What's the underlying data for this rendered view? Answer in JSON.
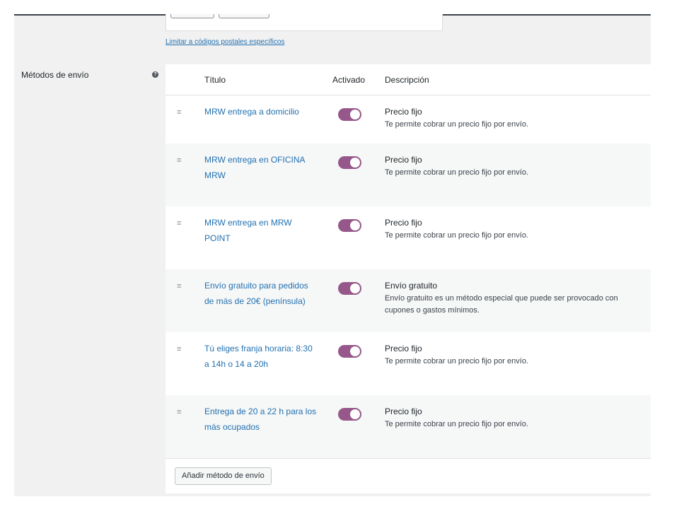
{
  "zone": {
    "limit_postcodes_link": "Limitar a códigos postales específicos",
    "shipping_methods_label": "Métodos de envío",
    "help_icon": "?"
  },
  "table": {
    "headers": {
      "title": "Título",
      "enabled": "Activado",
      "description": "Descripción"
    },
    "rows": [
      {
        "title": "MRW entrega a domicilio",
        "enabled": true,
        "type": "Precio fijo",
        "desc": "Te permite cobrar un precio fijo por envío."
      },
      {
        "title": "MRW entrega en OFICINA MRW",
        "enabled": true,
        "type": "Precio fijo",
        "desc": "Te permite cobrar un precio fijo por envío."
      },
      {
        "title": "MRW entrega en MRW POINT",
        "enabled": true,
        "type": "Precio fijo",
        "desc": "Te permite cobrar un precio fijo por envío."
      },
      {
        "title": "Envío gratuito para pedidos de más de 20€ (península)",
        "enabled": true,
        "type": "Envío gratuito",
        "desc": "Envío gratuito es un método especial que puede ser provocado con cupones o gastos mínimos."
      },
      {
        "title": "Tú eliges franja horaria: 8:30 a 14h o 14 a 20h",
        "enabled": true,
        "type": "Precio fijo",
        "desc": "Te permite cobrar un precio fijo por envío."
      },
      {
        "title": "Entrega de 20 a 22 h para los más ocupados",
        "enabled": true,
        "type": "Precio fijo",
        "desc": "Te permite cobrar un precio fijo por envío."
      }
    ],
    "add_button": "Añadir método de envío",
    "handle_glyph": "≡"
  },
  "colors": {
    "toggle_on": "#96588a",
    "link": "#2271b1"
  },
  "icons": {
    "handle": "drag-handle-icon",
    "help": "help-icon"
  }
}
